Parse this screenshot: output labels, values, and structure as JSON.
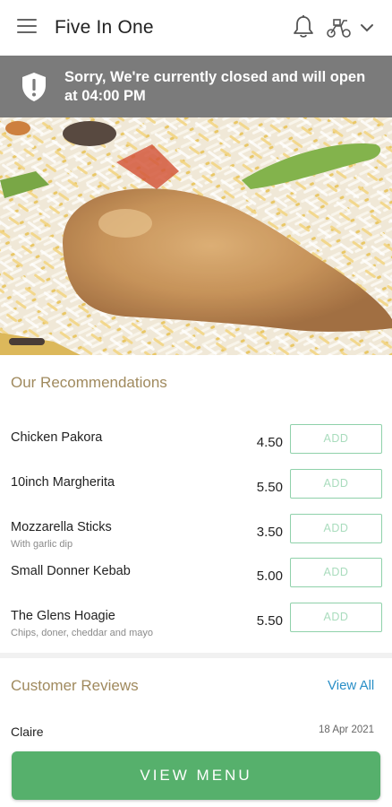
{
  "header": {
    "title": "Five In One",
    "icons": [
      "menu-icon",
      "bell-icon",
      "scooter-icon",
      "chevron-down-icon"
    ]
  },
  "banner": {
    "message": "Sorry, We're currently closed and will open at 04:00 PM",
    "icon": "shield-alert-icon",
    "background": "#7b7b7b"
  },
  "hero": {
    "description_icon": "biryani-photo"
  },
  "recommendations": {
    "title": "Our Recommendations",
    "items": [
      {
        "name": "Chicken Pakora",
        "description": "",
        "price": "4.50",
        "button": "ADD"
      },
      {
        "name": "10inch Margherita",
        "description": "",
        "price": "5.50",
        "button": "ADD"
      },
      {
        "name": "Mozzarella Sticks",
        "description": "With garlic dip",
        "price": "3.50",
        "button": "ADD"
      },
      {
        "name": "Small Donner Kebab",
        "description": "",
        "price": "5.00",
        "button": "ADD"
      },
      {
        "name": "The Glens Hoagie",
        "description": "Chips, doner, cheddar and mayo",
        "price": "5.50",
        "button": "ADD"
      }
    ]
  },
  "reviews": {
    "title": "Customer Reviews",
    "view_all": "View All",
    "first_reviewer": "Claire",
    "first_date": "18 Apr 2021"
  },
  "footer": {
    "view_menu_label": "VIEW MENU"
  },
  "colors": {
    "accent_green": "#56b06c",
    "section_title": "#a08a5e",
    "link_blue": "#2a8fc7",
    "add_border": "#8fd1aa"
  }
}
